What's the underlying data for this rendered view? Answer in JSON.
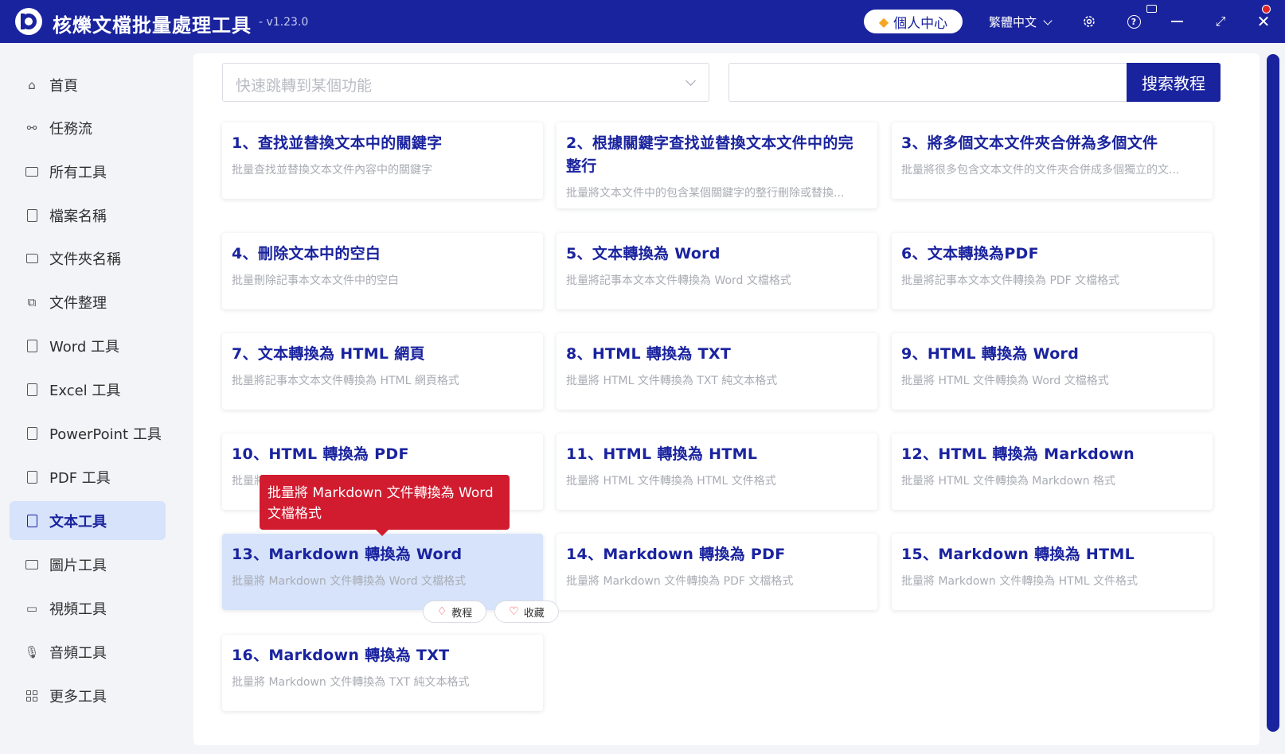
{
  "app": {
    "title": "核爍文檔批量處理工具",
    "version": "- v1.23.0",
    "personal_center": "個人中心",
    "language": "繁體中文"
  },
  "sidebar": {
    "items": [
      {
        "label": "首頁",
        "icon": "home-icon"
      },
      {
        "label": "任務流",
        "icon": "workflow-icon"
      },
      {
        "label": "所有工具",
        "icon": "monitor-icon"
      },
      {
        "label": "檔案名稱",
        "icon": "file-copy-icon"
      },
      {
        "label": "文件夾名稱",
        "icon": "folder-icon"
      },
      {
        "label": "文件整理",
        "icon": "organize-icon"
      },
      {
        "label": "Word 工具",
        "icon": "word-doc-icon"
      },
      {
        "label": "Excel 工具",
        "icon": "excel-doc-icon"
      },
      {
        "label": "PowerPoint 工具",
        "icon": "ppt-doc-icon"
      },
      {
        "label": "PDF 工具",
        "icon": "pdf-doc-icon"
      },
      {
        "label": "文本工具",
        "icon": "text-doc-icon",
        "active": true
      },
      {
        "label": "圖片工具",
        "icon": "image-icon"
      },
      {
        "label": "視頻工具",
        "icon": "video-icon"
      },
      {
        "label": "音頻工具",
        "icon": "microphone-icon"
      },
      {
        "label": "更多工具",
        "icon": "grid-icon"
      }
    ]
  },
  "toolbar": {
    "quick_jump_placeholder": "快速跳轉到某個功能",
    "search_value": "",
    "search_button": "搜索教程"
  },
  "cards": [
    {
      "title": "1、查找並替換文本中的關鍵字",
      "desc": "批量查找並替換文本文件內容中的關鍵字"
    },
    {
      "title": "2、根據關鍵字查找並替換文本文件中的完整行",
      "desc": "批量將文本文件中的包含某個關鍵字的整行刪除或替換..."
    },
    {
      "title": "3、將多個文本文件夾合併為多個文件",
      "desc": "批量將很多包含文本文件的文件夾合併成多個獨立的文..."
    },
    {
      "title": "4、刪除文本中的空白",
      "desc": "批量刪除記事本文本文件中的空白"
    },
    {
      "title": "5、文本轉換為 Word",
      "desc": "批量將記事本文本文件轉換為 Word 文檔格式"
    },
    {
      "title": "6、文本轉換為PDF",
      "desc": "批量將記事本文本文件轉換為 PDF 文檔格式"
    },
    {
      "title": "7、文本轉換為 HTML 網頁",
      "desc": "批量將記事本文本文件轉換為 HTML 網頁格式"
    },
    {
      "title": "8、HTML 轉換為 TXT",
      "desc": "批量將 HTML 文件轉換為 TXT 純文本格式"
    },
    {
      "title": "9、HTML 轉換為 Word",
      "desc": "批量將 HTML 文件轉換為 Word 文檔格式"
    },
    {
      "title": "10、HTML 轉換為 PDF",
      "desc": "批量將"
    },
    {
      "title": "11、HTML 轉換為 HTML",
      "desc": "批量將 HTML 文件轉換為 HTML 文件格式"
    },
    {
      "title": "12、HTML 轉換為 Markdown",
      "desc": "批量將 HTML 文件轉換為 Markdown 格式"
    },
    {
      "title": "13、Markdown 轉換為 Word",
      "desc": "批量將 Markdown 文件轉換為 Word 文檔格式",
      "highlighted": true
    },
    {
      "title": "14、Markdown 轉換為 PDF",
      "desc": "批量將 Markdown 文件轉換為 PDF 文檔格式"
    },
    {
      "title": "15、Markdown 轉換為 HTML",
      "desc": "批量將 Markdown 文件轉換為 HTML 文件格式"
    },
    {
      "title": "16、Markdown 轉換為 TXT",
      "desc": "批量將 Markdown 文件轉換為 TXT 純文本格式"
    }
  ],
  "card_actions": {
    "tutorial": "教程",
    "favorite": "收藏"
  },
  "tooltip": {
    "text": "批量將 Markdown 文件轉換為 Word 文檔格式"
  },
  "colors": {
    "brand": "#1a239e",
    "active_bg": "#d6e3fb",
    "tooltip_bg": "#d11b2f",
    "muted_text": "#a9acb3"
  }
}
